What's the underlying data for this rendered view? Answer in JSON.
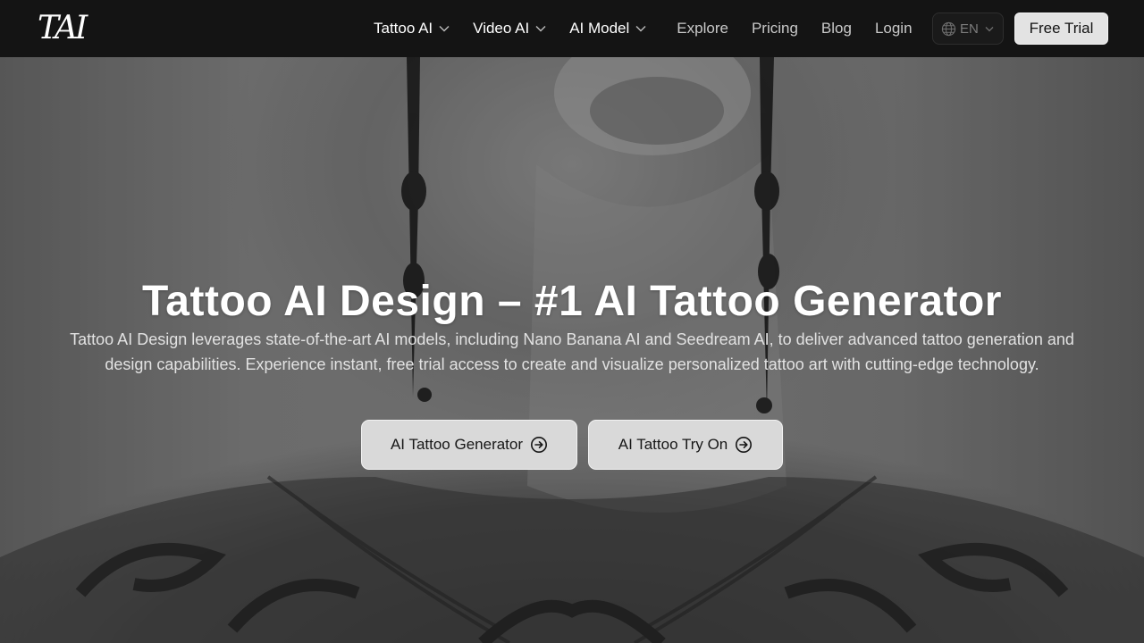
{
  "header": {
    "logo_text": "TAI",
    "nav": [
      {
        "label": "Tattoo AI",
        "has_dropdown": true
      },
      {
        "label": "Video AI",
        "has_dropdown": true
      },
      {
        "label": "AI Model",
        "has_dropdown": true
      },
      {
        "label": "Explore",
        "has_dropdown": false
      },
      {
        "label": "Pricing",
        "has_dropdown": false
      },
      {
        "label": "Blog",
        "has_dropdown": false
      },
      {
        "label": "Login",
        "has_dropdown": false
      }
    ],
    "language": {
      "icon": "globe-icon",
      "value": "EN"
    },
    "free_trial_label": "Free Trial"
  },
  "hero": {
    "title": "Tattoo AI Design – #1 AI Tattoo Generator",
    "description": "Tattoo AI Design leverages state-of-the-art AI models, including Nano Banana AI and Seedream AI, to deliver advanced tattoo generation and design capabilities. Experience instant, free trial access to create and visualize personalized tattoo art with cutting-edge technology.",
    "buttons": [
      {
        "label": "AI Tattoo Generator",
        "icon": "arrow-right-circle-icon"
      },
      {
        "label": "AI Tattoo Try On",
        "icon": "arrow-right-circle-icon"
      }
    ]
  },
  "colors": {
    "header_bg": "#141414",
    "button_bg": "#d9d9d9",
    "text_light": "#ffffff"
  }
}
